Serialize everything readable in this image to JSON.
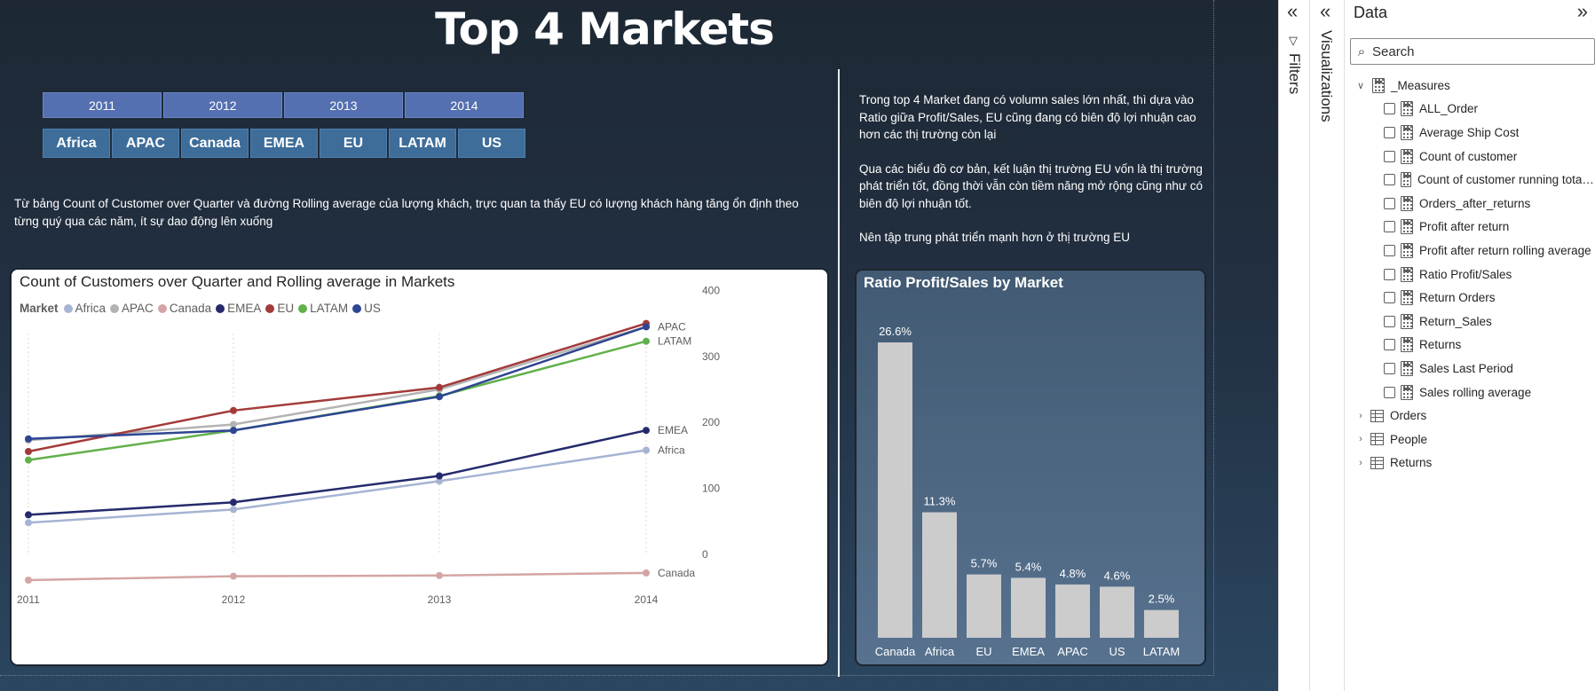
{
  "report": {
    "title": "Top 4 Markets",
    "year_slicer": [
      "2011",
      "2012",
      "2013",
      "2014"
    ],
    "market_slicer": [
      "Africa",
      "APAC",
      "Canada",
      "EMEA",
      "EU",
      "LATAM",
      "US"
    ],
    "narrative_left": "Từ bảng Count of Customer over Quarter và đường Rolling average của lượng khách, trực quan ta thấy EU có lượng khách hàng tăng ổn định theo từng quý qua các năm, ít sự dao động lên xuống",
    "narrative_right": [
      "Trong top 4 Market đang có volumn sales lớn nhất, thì dựa vào Ratio giữa Profit/Sales, EU cũng đang có biên độ lợi nhuận cao hơn các thị trường còn lại",
      "Qua các biểu đồ cơ bản, kết luận thị trường EU vốn là thị trường phát triển tốt, đồng thời vẫn còn tiềm năng mở rộng cũng như có biên độ lợi nhuận tốt.",
      "Nên tập trung phát triển mạnh hơn ở thị trường EU"
    ]
  },
  "chart_data": [
    {
      "type": "line",
      "title": "Count of Customers over Quarter and Rolling average in Markets",
      "legend_title": "Market",
      "legend_position": "top-left",
      "x": [
        "2011",
        "2012",
        "2013",
        "2014"
      ],
      "yticks": [
        "0",
        "100",
        "200",
        "300",
        "400"
      ],
      "ylim": [
        0,
        420
      ],
      "grid": "vertical-dotted",
      "series": [
        {
          "name": "Africa",
          "color": "#a6b4d3",
          "values": [
            95,
            115,
            158,
            205
          ],
          "end_label": "Africa"
        },
        {
          "name": "APAC",
          "color": "#b3b3b3",
          "values": [
            220,
            244,
            297,
            392
          ],
          "end_label": "APAC"
        },
        {
          "name": "Canada",
          "color": "#d4a5a5",
          "values": [
            8,
            14,
            15,
            19
          ],
          "end_label": "Canada"
        },
        {
          "name": "EMEA",
          "color": "#252a6c",
          "values": [
            107,
            126,
            166,
            235
          ],
          "end_label": "EMEA"
        },
        {
          "name": "EU",
          "color": "#a33a3a",
          "values": [
            203,
            265,
            300,
            397
          ],
          "end_label": ""
        },
        {
          "name": "LATAM",
          "color": "#62b04a",
          "values": [
            190,
            235,
            287,
            370
          ],
          "end_label": "LATAM"
        },
        {
          "name": "US",
          "color": "#2d4592",
          "values": [
            222,
            235,
            286,
            392
          ],
          "end_label": ""
        }
      ]
    },
    {
      "type": "bar",
      "title": "Ratio Profit/Sales by Market",
      "categories": [
        "Canada",
        "Africa",
        "EU",
        "EMEA",
        "APAC",
        "US",
        "LATAM"
      ],
      "values": [
        26.6,
        11.3,
        5.7,
        5.4,
        4.8,
        4.6,
        2.5
      ],
      "labels": [
        "26.6%",
        "11.3%",
        "5.7%",
        "5.4%",
        "4.8%",
        "4.6%",
        "2.5%"
      ],
      "color": "#cccccc"
    }
  ],
  "panes": {
    "filters_label": "Filters",
    "visualizations_label": "Visualizations",
    "data": {
      "title": "Data",
      "search_placeholder": "Search",
      "measures_group": "_Measures",
      "measures": [
        "ALL_Order",
        "Average Ship Cost",
        "Count of customer",
        "Count of customer running total in Order Date",
        "Orders_after_returns",
        "Profit after return",
        "Profit after return rolling average",
        "Ratio Profit/Sales",
        "Return Orders",
        "Return_Sales",
        "Returns",
        "Sales Last Period",
        "Sales rolling average"
      ],
      "tables": [
        "Orders",
        "People",
        "Returns"
      ]
    }
  }
}
